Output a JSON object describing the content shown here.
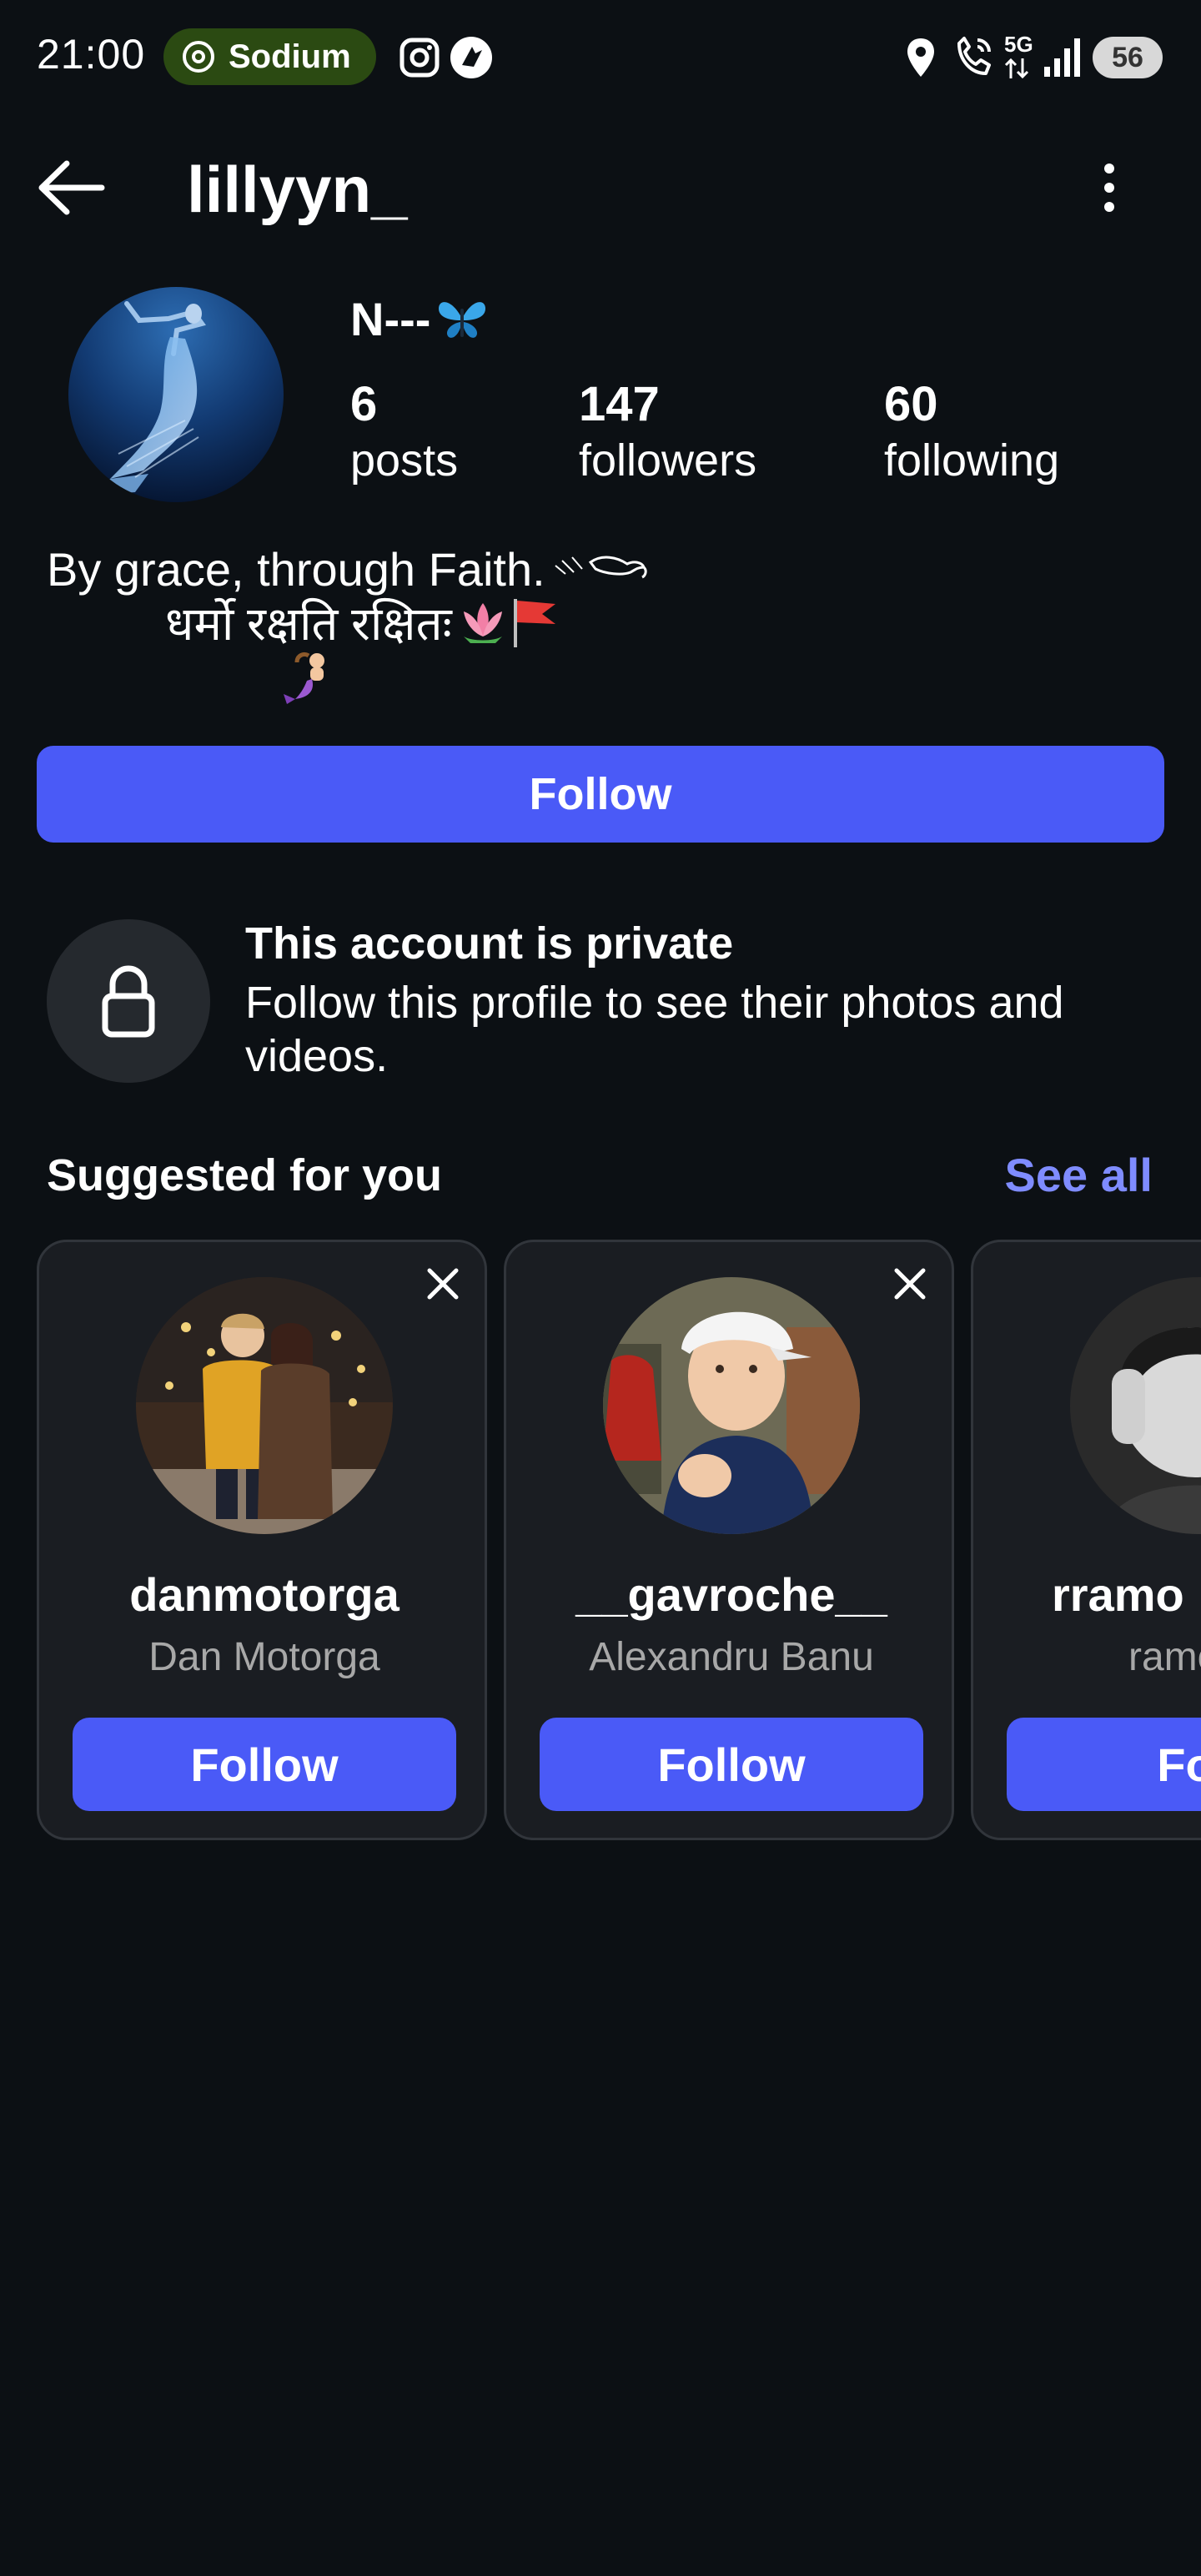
{
  "status_bar": {
    "time": "21:00",
    "app_pill_label": "Sodium",
    "network": "5G",
    "battery": "56",
    "icons": [
      "sodium-logo-icon",
      "instagram-icon",
      "app-icon",
      "location-icon",
      "wifi-calling-icon",
      "signal-icon",
      "battery-icon"
    ]
  },
  "header": {
    "username": "lillyyn_",
    "back_icon": "arrow-left-icon",
    "more_icon": "more-vertical-icon"
  },
  "profile": {
    "display_name": "N---",
    "display_name_emoji": "butterfly",
    "stats": [
      {
        "num": "6",
        "label": "posts"
      },
      {
        "num": "147",
        "label": "followers"
      },
      {
        "num": "60",
        "label": "following"
      }
    ],
    "bio": {
      "line1": "By grace, through Faith.",
      "line2": "धर्मो रक्षति रक्षितः",
      "line3_emoji": "mermaid"
    },
    "follow_label": "Follow"
  },
  "private": {
    "title": "This account is private",
    "description": "Follow this profile to see their photos and videos."
  },
  "suggested": {
    "title": "Suggested for you",
    "see_all": "See all",
    "cards": [
      {
        "username": "danmotorga",
        "full_name": "Dan Motorga",
        "follow": "Follow"
      },
      {
        "username": "__gavroche__",
        "full_name": "Alexandru Banu",
        "follow": "Follow"
      },
      {
        "username": "rramo",
        "full_name": "ramo",
        "follow": "Foll"
      }
    ]
  },
  "colors": {
    "background": "#0c1014",
    "primary_button": "#4a5af7",
    "link": "#7f8cff",
    "card": "#1a1d22",
    "muted_text": "#a8a8a8",
    "pill": "#2b4a12"
  }
}
